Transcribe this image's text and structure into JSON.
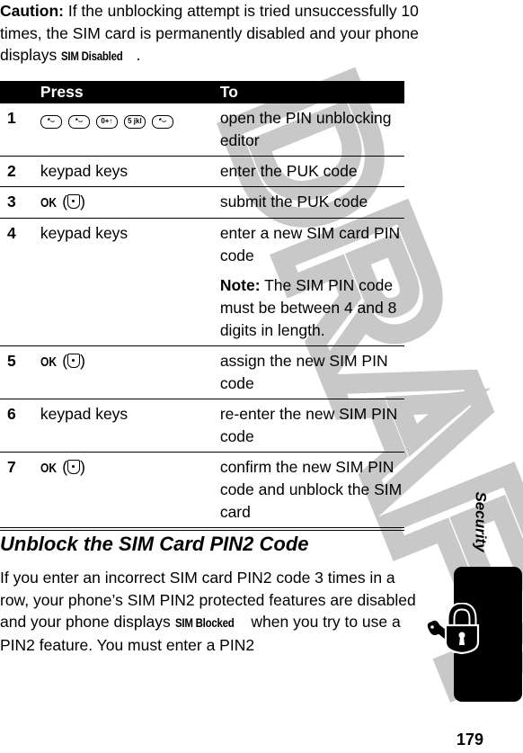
{
  "watermark": "DRAFT",
  "caution": {
    "label": "Caution:",
    "text": " If the unblocking attempt is tried unsuccessfully 10 times, the SIM card is permanently disabled and your phone displays ",
    "display": "SIM Disabled",
    "end": "."
  },
  "table": {
    "headers": {
      "press": "Press",
      "to": "To"
    },
    "rows": [
      {
        "num": "1",
        "press_type": "keys",
        "keys": [
          "*⌣",
          "*⌣",
          "0+↑",
          "5 jkl",
          "*⌣"
        ],
        "to": "open the PIN unblocking editor"
      },
      {
        "num": "2",
        "press": "keypad keys",
        "to": "enter the PUK code"
      },
      {
        "num": "3",
        "ok": "OK",
        "to": "submit the PUK code"
      },
      {
        "num": "4",
        "press": "keypad keys",
        "to": "enter a new SIM card PIN code",
        "note_label": "Note:",
        "note_text": " The SIM PIN code must be between 4 and 8 digits in length."
      },
      {
        "num": "5",
        "ok": "OK",
        "to": "assign the new SIM PIN code"
      },
      {
        "num": "6",
        "press": "keypad keys",
        "to": "re-enter the new SIM PIN code"
      },
      {
        "num": "7",
        "ok": "OK",
        "to": "confirm the new SIM PIN code and unblock the SIM card"
      }
    ]
  },
  "section": {
    "heading": "Unblock the SIM Card PIN2 Code",
    "text_before": "If you enter an incorrect SIM card PIN2 code 3 times in a row, your phone’s SIM PIN2 protected features are disabled and your phone displays ",
    "display": "SIM Blocked",
    "text_after": " when you try to use a PIN2 feature. You must enter a PIN2"
  },
  "sidebar": {
    "title": "Security",
    "icon": "lock-and-key-icon"
  },
  "page_number": "179"
}
